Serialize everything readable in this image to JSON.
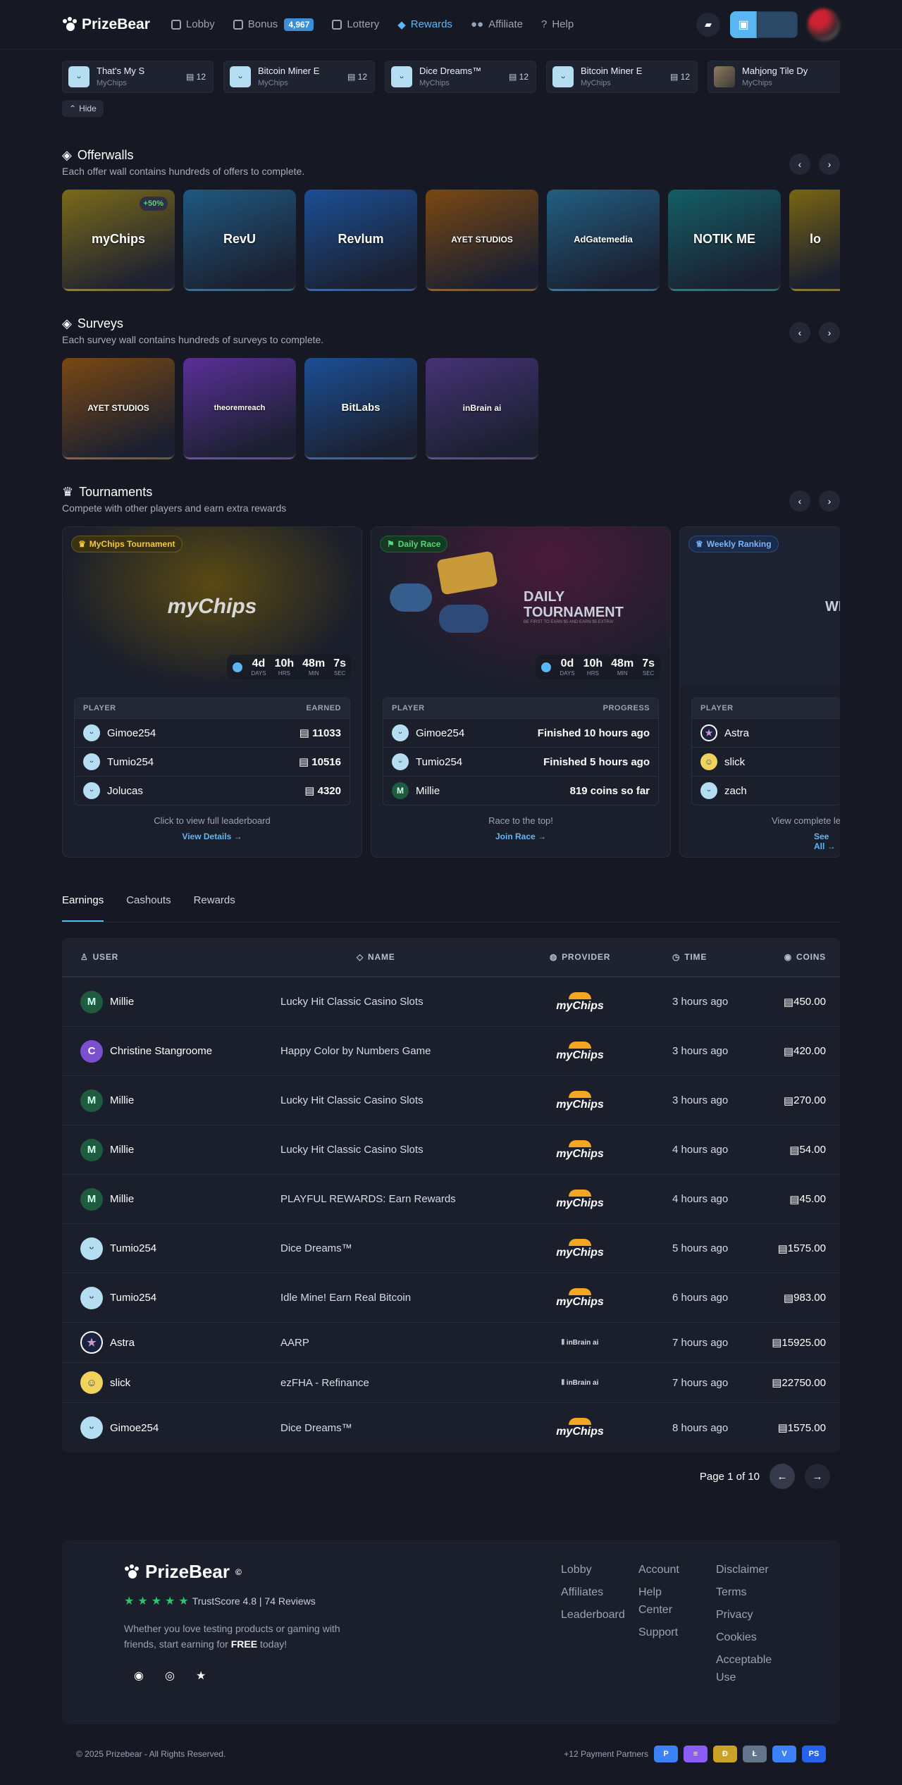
{
  "nav": {
    "brand": "PrizeBear",
    "items": [
      {
        "label": "Lobby"
      },
      {
        "label": "Bonus"
      },
      {
        "label": "Lottery"
      },
      {
        "label": "Rewards"
      },
      {
        "label": "Affiliate"
      },
      {
        "label": "Help"
      }
    ],
    "bonus_badge": "4,967"
  },
  "games": [
    {
      "name": "That's My S",
      "provider": "MyChips",
      "count": "12"
    },
    {
      "name": "Bitcoin Miner E",
      "provider": "MyChips",
      "count": "12"
    },
    {
      "name": "Dice Dreams™",
      "provider": "MyChips",
      "count": "12"
    },
    {
      "name": "Bitcoin Miner E",
      "provider": "MyChips",
      "count": "12"
    },
    {
      "name": "Mahjong Tile Dy",
      "provider": "MyChips",
      "count": ""
    }
  ],
  "hide_label": "Hide",
  "offerwalls": {
    "title": "Offerwalls",
    "subtitle": "Each offer wall contains hundreds of offers to complete.",
    "cards": [
      {
        "label": "myChips",
        "badge": "+50%",
        "color": "#6b5a16"
      },
      {
        "label": "RevU",
        "color": "#1f4f72"
      },
      {
        "label": "Revlum",
        "color": "#1b4a8a"
      },
      {
        "label": "AYET STUDIOS",
        "color": "#6a3f12"
      },
      {
        "label": "AdGatemedia",
        "color": "#1e5577"
      },
      {
        "label": "NOTIK ME",
        "color": "#12555b"
      },
      {
        "label": "lo",
        "color": "#665514"
      }
    ]
  },
  "surveys": {
    "title": "Surveys",
    "subtitle": "Each survey wall contains hundreds of surveys to complete.",
    "cards": [
      {
        "label": "AYET STUDIOS",
        "color": "#6a3f12"
      },
      {
        "label": "theoremreach",
        "color": "#4e2c82"
      },
      {
        "label": "BitLabs",
        "color": "#1b4a8a"
      },
      {
        "label": "inBrain ai",
        "color": "#3b2b6a"
      }
    ]
  },
  "tournaments": {
    "title": "Tournaments",
    "subtitle": "Compete with other players and earn extra rewards",
    "cards": [
      {
        "tag": "MyChips Tournament",
        "hero": "myChips",
        "timer": {
          "d": "4",
          "h": "10",
          "m": "48",
          "s": "7"
        },
        "col_left": "PLAYER",
        "col_right": "EARNED",
        "rows": [
          {
            "user": "Gimoe254",
            "value": "11033"
          },
          {
            "user": "Tumio254",
            "value": "10516"
          },
          {
            "user": "Jolucas",
            "value": "4320"
          }
        ],
        "footer": "Click to view full leaderboard",
        "link": "View Details →"
      },
      {
        "tag": "Daily Race",
        "hero": "DAILY TOURNAMENT",
        "hero_sub": "BE FIRST TO EARN $5 AND EARN $5 EXTRA!",
        "timer": {
          "d": "0",
          "h": "10",
          "m": "48",
          "s": "7"
        },
        "col_left": "PLAYER",
        "col_right": "PROGRESS",
        "rows": [
          {
            "user": "Gimoe254",
            "value": "Finished 10 hours ago"
          },
          {
            "user": "Tumio254",
            "value": "Finished 5 hours ago"
          },
          {
            "user": "Millie",
            "value": "819 coins so far"
          }
        ],
        "footer": "Race to the top!",
        "link": "Join Race →"
      },
      {
        "tag": "Weekly Ranking",
        "hero": "WEEKLY LEADERBOARD",
        "col_left": "PLAYER",
        "rows": [
          {
            "user": "Astra"
          },
          {
            "user": "slick"
          },
          {
            "user": "zach"
          }
        ],
        "footer": "View complete leaderboard",
        "link": "See All →"
      }
    ],
    "timer_labels": {
      "d": "DAYS",
      "h": "HRS",
      "m": "MIN",
      "s": "SEC"
    },
    "timer_units": {
      "d": "d",
      "h": "h",
      "m": "m",
      "s": "s"
    }
  },
  "tabs": [
    "Earnings",
    "Cashouts",
    "Rewards"
  ],
  "table": {
    "headers": {
      "user": "USER",
      "name": "NAME",
      "provider": "PROVIDER",
      "time": "TIME",
      "coins": "COINS"
    },
    "rows": [
      {
        "avatar": "M",
        "user": "Millie",
        "name": "Lucky Hit Classic Casino Slots",
        "provider": "myChips",
        "time": "3 hours ago",
        "coins": "450.00"
      },
      {
        "avatar": "C",
        "user": "Christine Stangroome",
        "name": "Happy Color by Numbers Game",
        "provider": "myChips",
        "time": "3 hours ago",
        "coins": "420.00"
      },
      {
        "avatar": "M",
        "user": "Millie",
        "name": "Lucky Hit Classic Casino Slots",
        "provider": "myChips",
        "time": "3 hours ago",
        "coins": "270.00"
      },
      {
        "avatar": "M",
        "user": "Millie",
        "name": "Lucky Hit Classic Casino Slots",
        "provider": "myChips",
        "time": "4 hours ago",
        "coins": "54.00"
      },
      {
        "avatar": "M",
        "user": "Millie",
        "name": "PLAYFUL REWARDS: Earn Rewards",
        "provider": "myChips",
        "time": "4 hours ago",
        "coins": "45.00"
      },
      {
        "avatar": "",
        "user": "Tumio254",
        "name": "Dice Dreams™",
        "provider": "myChips",
        "time": "5 hours ago",
        "coins": "1575.00"
      },
      {
        "avatar": "",
        "user": "Tumio254",
        "name": "Idle Mine! Earn Real Bitcoin",
        "provider": "myChips",
        "time": "6 hours ago",
        "coins": "983.00"
      },
      {
        "avatar": "",
        "user": "Astra",
        "name": "AARP",
        "provider": "inBrain ai",
        "time": "7 hours ago",
        "coins": "15925.00"
      },
      {
        "avatar": "",
        "user": "slick",
        "name": "ezFHA - Refinance",
        "provider": "inBrain ai",
        "time": "7 hours ago",
        "coins": "22750.00"
      },
      {
        "avatar": "",
        "user": "Gimoe254",
        "name": "Dice Dreams™",
        "provider": "myChips",
        "time": "8 hours ago",
        "coins": "1575.00"
      }
    ],
    "page": "Page 1 of 10"
  },
  "footer": {
    "brand": "PrizeBear",
    "trust": "TrustScore 4.8 | 74 Reviews",
    "desc_pre": "Whether you love testing products or gaming with friends, start earning for ",
    "desc_bold": "FREE",
    "desc_post": " today!",
    "col1": [
      "Lobby",
      "Affiliates",
      "Leaderboard"
    ],
    "col2": [
      "Account",
      "Help Center",
      "Support"
    ],
    "col3": [
      "Disclaimer",
      "Terms",
      "Privacy",
      "Cookies",
      "Acceptable Use"
    ],
    "copyright": "© 2025 Prizebear - All Rights Reserved.",
    "payment_partners": "+12 Payment Partners",
    "payments": [
      {
        "icon": "paypal-icon",
        "glyph": "P",
        "color": "#3b82f6"
      },
      {
        "icon": "stacks-icon",
        "glyph": "≡",
        "color": "#8b5cf6"
      },
      {
        "icon": "dogecoin-icon",
        "glyph": "Ð",
        "color": "#c9a227"
      },
      {
        "icon": "litecoin-icon",
        "glyph": "Ł",
        "color": "#64748b"
      },
      {
        "icon": "venmo-icon",
        "glyph": "V",
        "color": "#3b82f6"
      },
      {
        "icon": "playstation-icon",
        "glyph": "PS",
        "color": "#2563eb"
      }
    ]
  }
}
